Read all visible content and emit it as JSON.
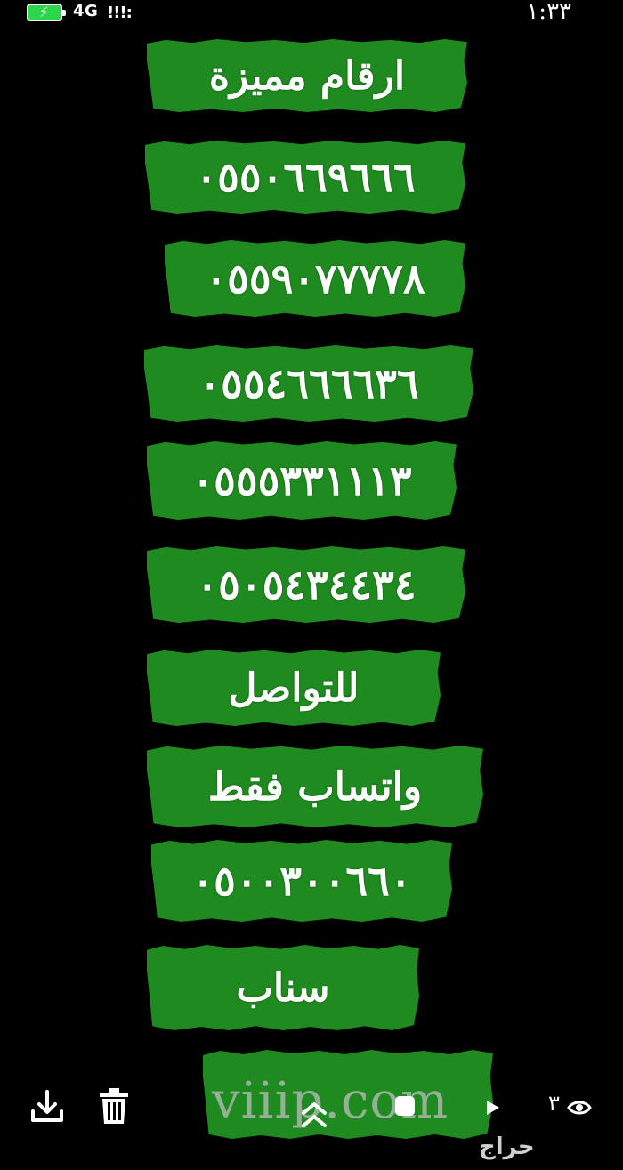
{
  "status_bar": {
    "network": "4G",
    "signal": "!!!:",
    "time": "١:٣٣"
  },
  "banners": [
    "ارقام مميزة",
    "٠٥٥٠٦٦٩٦٦٦",
    "٠٥٥٩٠٧٧٧٧٨",
    "٠٥٥٤٦٦٦٦٣٦",
    "٠٥٥٥٣٣١١١٣",
    "٠٥٠٥٤٣٤٤٣٤",
    "للتواصل",
    "واتساب فقط",
    "٠٥٠٠٣٠٠٦٦٠",
    "سناب"
  ],
  "watermark": "viiip.com",
  "brand": "حراج",
  "toolbar": {
    "count": "٣",
    "icons": [
      "download-icon",
      "trash-icon",
      "chevron-up-icon",
      "stop-icon",
      "play-icon",
      "eye-icon"
    ]
  },
  "colors": {
    "background": "#000000",
    "banner_green": "#1f8a1f",
    "battery_green": "#2bd64a"
  }
}
